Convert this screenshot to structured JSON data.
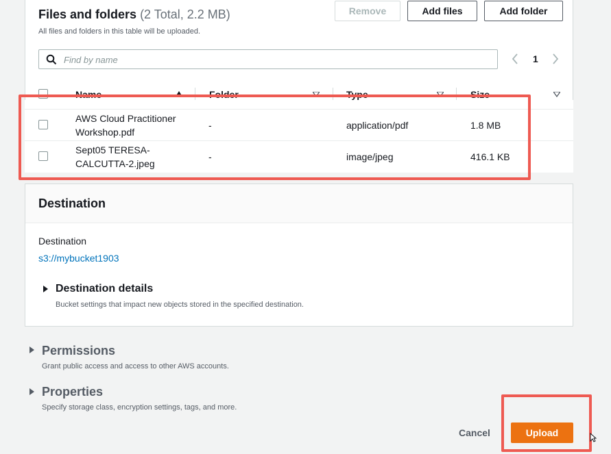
{
  "files_panel": {
    "title": "Files and folders",
    "count_text": "(2 Total, 2.2 MB)",
    "subtitle": "All files and folders in this table will be uploaded.",
    "remove_label": "Remove",
    "add_files_label": "Add files",
    "add_folder_label": "Add folder",
    "search_placeholder": "Find by name",
    "page_number": "1",
    "columns": [
      "Name",
      "Folder",
      "Type",
      "Size"
    ],
    "rows": [
      {
        "name_line1": "AWS Cloud Practitioner",
        "name_line2": "Workshop.pdf",
        "folder": "-",
        "type": "application/pdf",
        "size": "1.8 MB"
      },
      {
        "name_line1": "Sept05 TERESA-",
        "name_line2": "CALCUTTA-2.jpeg",
        "folder": "-",
        "type": "image/jpeg",
        "size": "416.1 KB"
      }
    ]
  },
  "destination_panel": {
    "title": "Destination",
    "label": "Destination",
    "value": "s3://mybucket1903",
    "details_title": "Destination details",
    "details_desc": "Bucket settings that impact new objects stored in the specified destination."
  },
  "permissions": {
    "title": "Permissions",
    "desc": "Grant public access and access to other AWS accounts."
  },
  "properties": {
    "title": "Properties",
    "desc": "Specify storage class, encryption settings, tags, and more."
  },
  "footer": {
    "cancel_label": "Cancel",
    "upload_label": "Upload"
  },
  "colors": {
    "highlight": "#ee5a52",
    "primary": "#ec7211",
    "link": "#0073bb"
  }
}
